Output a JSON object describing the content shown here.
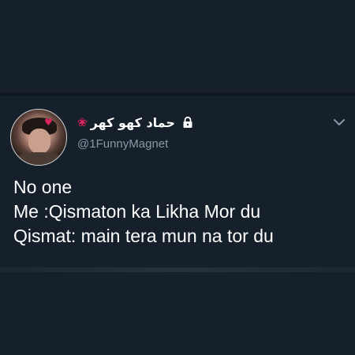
{
  "tweet": {
    "display_name": "حماد کھو کھر",
    "handle": "@1FunnyMagnet",
    "lines": [
      "No one",
      "Me :Qismaton ka Likha Mor du",
      "Qismat: main tera mun na tor du"
    ]
  },
  "icons": {
    "avatar_badge": "heart-icon",
    "name_emoji": "rose-icon",
    "protected": "lock-icon",
    "menu": "chevron-down-icon"
  },
  "colors": {
    "background": "#15202b",
    "text": "#ffffff",
    "secondary_text": "#8899a6"
  }
}
